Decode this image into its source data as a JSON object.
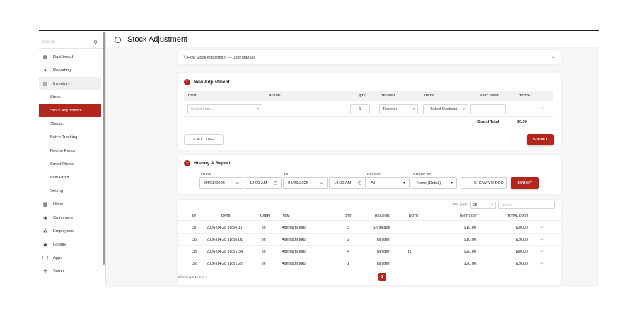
{
  "sidebar": {
    "search_placeholder": "Search",
    "items": [
      {
        "label": "Dashboard",
        "icon": "dashboard-icon",
        "glyph": "▦"
      },
      {
        "label": "Reporting",
        "icon": "reporting-icon",
        "glyph": "▾"
      },
      {
        "label": "Inventory",
        "icon": "inventory-icon",
        "glyph": "▤"
      },
      {
        "label": "Stock"
      },
      {
        "label": "Stock Adjustment"
      },
      {
        "label": "Classic"
      },
      {
        "label": "Batch Tracking"
      },
      {
        "label": "Recipe Report"
      },
      {
        "label": "Smart Prices"
      },
      {
        "label": "Item Profit"
      },
      {
        "label": "Setting"
      },
      {
        "label": "Menu",
        "icon": "menu-icon",
        "glyph": "▦"
      },
      {
        "label": "Customers",
        "icon": "customers-icon",
        "glyph": "◉"
      },
      {
        "label": "Employees",
        "icon": "employees-icon",
        "glyph": "⁂"
      },
      {
        "label": "Loyalty",
        "icon": "loyalty-icon",
        "glyph": "◆"
      },
      {
        "label": "Apps",
        "icon": "apps-icon",
        "glyph": "⋮⋮"
      },
      {
        "label": "Setup",
        "icon": "setup-icon",
        "glyph": "✲"
      }
    ]
  },
  "header": {
    "title": "Stock Adjustment"
  },
  "manual": {
    "text": "ⓘ How Stock Adjustment — User Manual"
  },
  "new_adjustment": {
    "step": "1",
    "title": "New Adjustment",
    "columns": {
      "item": "ITEM",
      "batch": "BATCH",
      "qty": "QTY",
      "reason": "REASON",
      "note": "NOTE",
      "unit_cost": "UNIT COST",
      "total": "TOTAL"
    },
    "row": {
      "item_placeholder": "Select item...",
      "batch": "-",
      "qty": "1",
      "reason": "Transfer",
      "note": "-- Select Destinati",
      "unit_cost": "-",
      "total": "-"
    },
    "grand_total_label": "Grand Total",
    "grand_total_value": "$0.00",
    "add_line_label": "+ ADD LINE",
    "submit_label": "SUBMIT"
  },
  "history": {
    "step": "2",
    "title": "History & Report",
    "from_label": "FROM",
    "from_date": "04/28/2026",
    "from_time": "12:00 AM",
    "to_label": "TO",
    "to_date": "04/29/2026",
    "to_time": "12:00 AM",
    "reason_label": "REASON",
    "reason_value": "All",
    "group_label": "GROUP BY",
    "group_value": "None (Detail)",
    "show_voided_label": "SHOW VOIDED",
    "submit_label": "SUBMIT"
  },
  "table": {
    "per_page_label": "Per page",
    "per_page_value": "25",
    "search_placeholder": "Search...",
    "columns": {
      "id": "ID",
      "date": "DATE",
      "user": "USER",
      "item": "ITEM",
      "qty": "QTY",
      "reason": "REASON",
      "note": "NOTE",
      "unit_cost": "UNIT COST",
      "total_cost": "TOTAL COST"
    },
    "rows": [
      {
        "id": "37",
        "date": "2026-04-28 18:56:17",
        "user": "jin",
        "item": "Agedashi tofu",
        "qty": "3",
        "reason": "Shrinkage",
        "note": "",
        "unit_cost": "$10.00",
        "total_cost": "$30.00"
      },
      {
        "id": "36",
        "date": "2026-04-28 18:56:01",
        "user": "jin",
        "item": "Agedashi tofu",
        "qty": "2",
        "reason": "Transfer",
        "note": "",
        "unit_cost": "$10.00",
        "total_cost": "$20.00"
      },
      {
        "id": "33",
        "date": "2026-04-28 18:51:34",
        "user": "jin",
        "item": "Agedashi tofu",
        "qty": "4",
        "reason": "Transfer",
        "note": "t1",
        "unit_cost": "$20.00",
        "total_cost": "$80.00"
      },
      {
        "id": "32",
        "date": "2026-04-28 18:51:22",
        "user": "jin",
        "item": "Agedashi tofu",
        "qty": "1",
        "reason": "Transfer",
        "note": "",
        "unit_cost": "$20.00",
        "total_cost": "$20.00"
      }
    ],
    "footer_info": "Showing 1 to 4 of 4",
    "current_page": "1"
  },
  "colors": {
    "accent": "#b3261e",
    "content_bg": "#f6f6f6"
  }
}
